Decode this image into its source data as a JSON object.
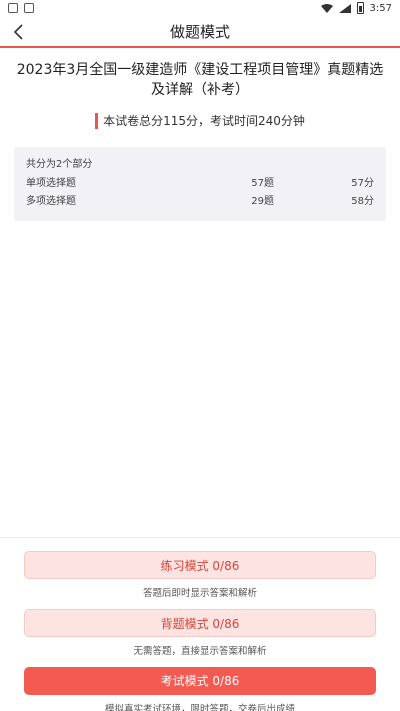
{
  "status": {
    "time": "3:57"
  },
  "header": {
    "title": "做题模式"
  },
  "exam": {
    "title": "2023年3月全国一级建造师《建设工程项目管理》真题精选及详解（补考）",
    "summary": "本试卷总分115分，考试时间240分钟"
  },
  "parts": {
    "heading": "共分为2个部分",
    "rows": [
      {
        "name": "单项选择题",
        "count": "57题",
        "score": "57分"
      },
      {
        "name": "多项选择题",
        "count": "29题",
        "score": "58分"
      }
    ]
  },
  "modes": [
    {
      "label": "练习模式  0/86",
      "desc": "答题后即时显示答案和解析"
    },
    {
      "label": "背题模式  0/86",
      "desc": "无需答题，直接显示答案和解析"
    },
    {
      "label": "考试模式  0/86",
      "desc": "模拟真实考试环境，限时答题，交卷后出成绩"
    }
  ],
  "colors": {
    "accent": "#e8574e",
    "button_light": "#fde4e2",
    "button_solid": "#f25a52",
    "panel": "#f1f1f6"
  }
}
